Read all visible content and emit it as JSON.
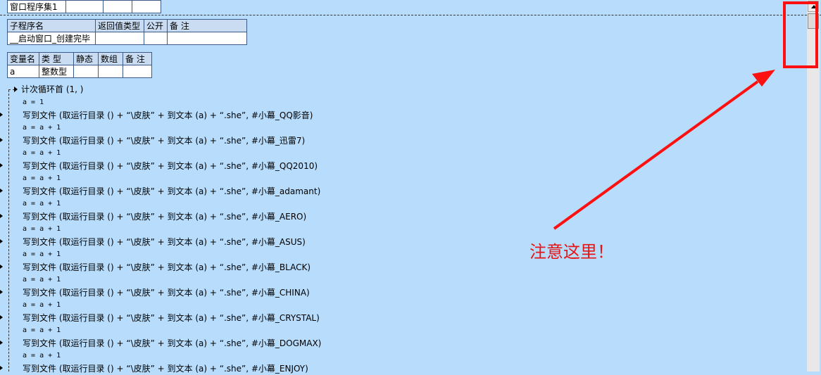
{
  "top_table": {
    "cells": [
      "窗口程序集1",
      "",
      "",
      ""
    ]
  },
  "sub_table": {
    "headers": [
      "子程序名",
      "返回值类型",
      "公开",
      "备 注"
    ],
    "row": [
      "__启动窗口_创建完毕",
      "",
      "",
      ""
    ]
  },
  "var_table": {
    "headers": [
      "变量名",
      "类 型",
      "静态",
      "数组",
      "备 注"
    ],
    "row": [
      "a",
      "整数型",
      "",
      "",
      ""
    ]
  },
  "loop": {
    "head": "计次循环首 (1, )"
  },
  "code_lines": [
    {
      "kind": "assign",
      "text": "a = 1"
    },
    {
      "kind": "write",
      "text": "写到文件 (取运行目录 () + “\\皮肤” + 到文本 (a) + “.she”, #小幕_QQ影音)"
    },
    {
      "kind": "assign",
      "text": "a = a + 1"
    },
    {
      "kind": "write",
      "text": "写到文件 (取运行目录 () + “\\皮肤” + 到文本 (a) + “.she”, #小幕_迅雷7)"
    },
    {
      "kind": "assign",
      "text": "a = a + 1"
    },
    {
      "kind": "write",
      "text": "写到文件 (取运行目录 () + “\\皮肤” + 到文本 (a) + “.she”, #小幕_QQ2010)"
    },
    {
      "kind": "assign",
      "text": "a = a + 1"
    },
    {
      "kind": "write",
      "text": "写到文件 (取运行目录 () + “\\皮肤” + 到文本 (a) + “.she”, #小幕_adamant)"
    },
    {
      "kind": "assign",
      "text": "a = a + 1"
    },
    {
      "kind": "write",
      "text": "写到文件 (取运行目录 () + “\\皮肤” + 到文本 (a) + “.she”, #小幕_AERO)"
    },
    {
      "kind": "assign",
      "text": "a = a + 1"
    },
    {
      "kind": "write",
      "text": "写到文件 (取运行目录 () + “\\皮肤” + 到文本 (a) + “.she”, #小幕_ASUS)"
    },
    {
      "kind": "assign",
      "text": "a = a + 1"
    },
    {
      "kind": "write",
      "text": "写到文件 (取运行目录 () + “\\皮肤” + 到文本 (a) + “.she”, #小幕_BLACK)"
    },
    {
      "kind": "assign",
      "text": "a = a + 1"
    },
    {
      "kind": "write",
      "text": "写到文件 (取运行目录 () + “\\皮肤” + 到文本 (a) + “.she”, #小幕_CHINA)"
    },
    {
      "kind": "assign",
      "text": "a = a + 1"
    },
    {
      "kind": "write",
      "text": "写到文件 (取运行目录 () + “\\皮肤” + 到文本 (a) + “.she”, #小幕_CRYSTAL)"
    },
    {
      "kind": "assign",
      "text": "a = a + 1"
    },
    {
      "kind": "write",
      "text": "写到文件 (取运行目录 () + “\\皮肤” + 到文本 (a) + “.she”, #小幕_DOGMAX)"
    },
    {
      "kind": "assign",
      "text": "a = a + 1"
    },
    {
      "kind": "write",
      "text": "写到文件 (取运行目录 () + “\\皮肤” + 到文本 (a) + “.she”, #小幕_ENJOY)"
    }
  ],
  "annotation": {
    "note": "注意这里！",
    "color": "#e61414"
  },
  "icons": {
    "scroll_up": "scroll-up-arrow-icon",
    "loop": "loop-arrow-icon",
    "line_marker": "breakpoint-marker-icon"
  },
  "colors": {
    "editor_background": "#b8dcfc",
    "table_border": "#3a5a8a",
    "annotation_red": "#ff1010"
  }
}
